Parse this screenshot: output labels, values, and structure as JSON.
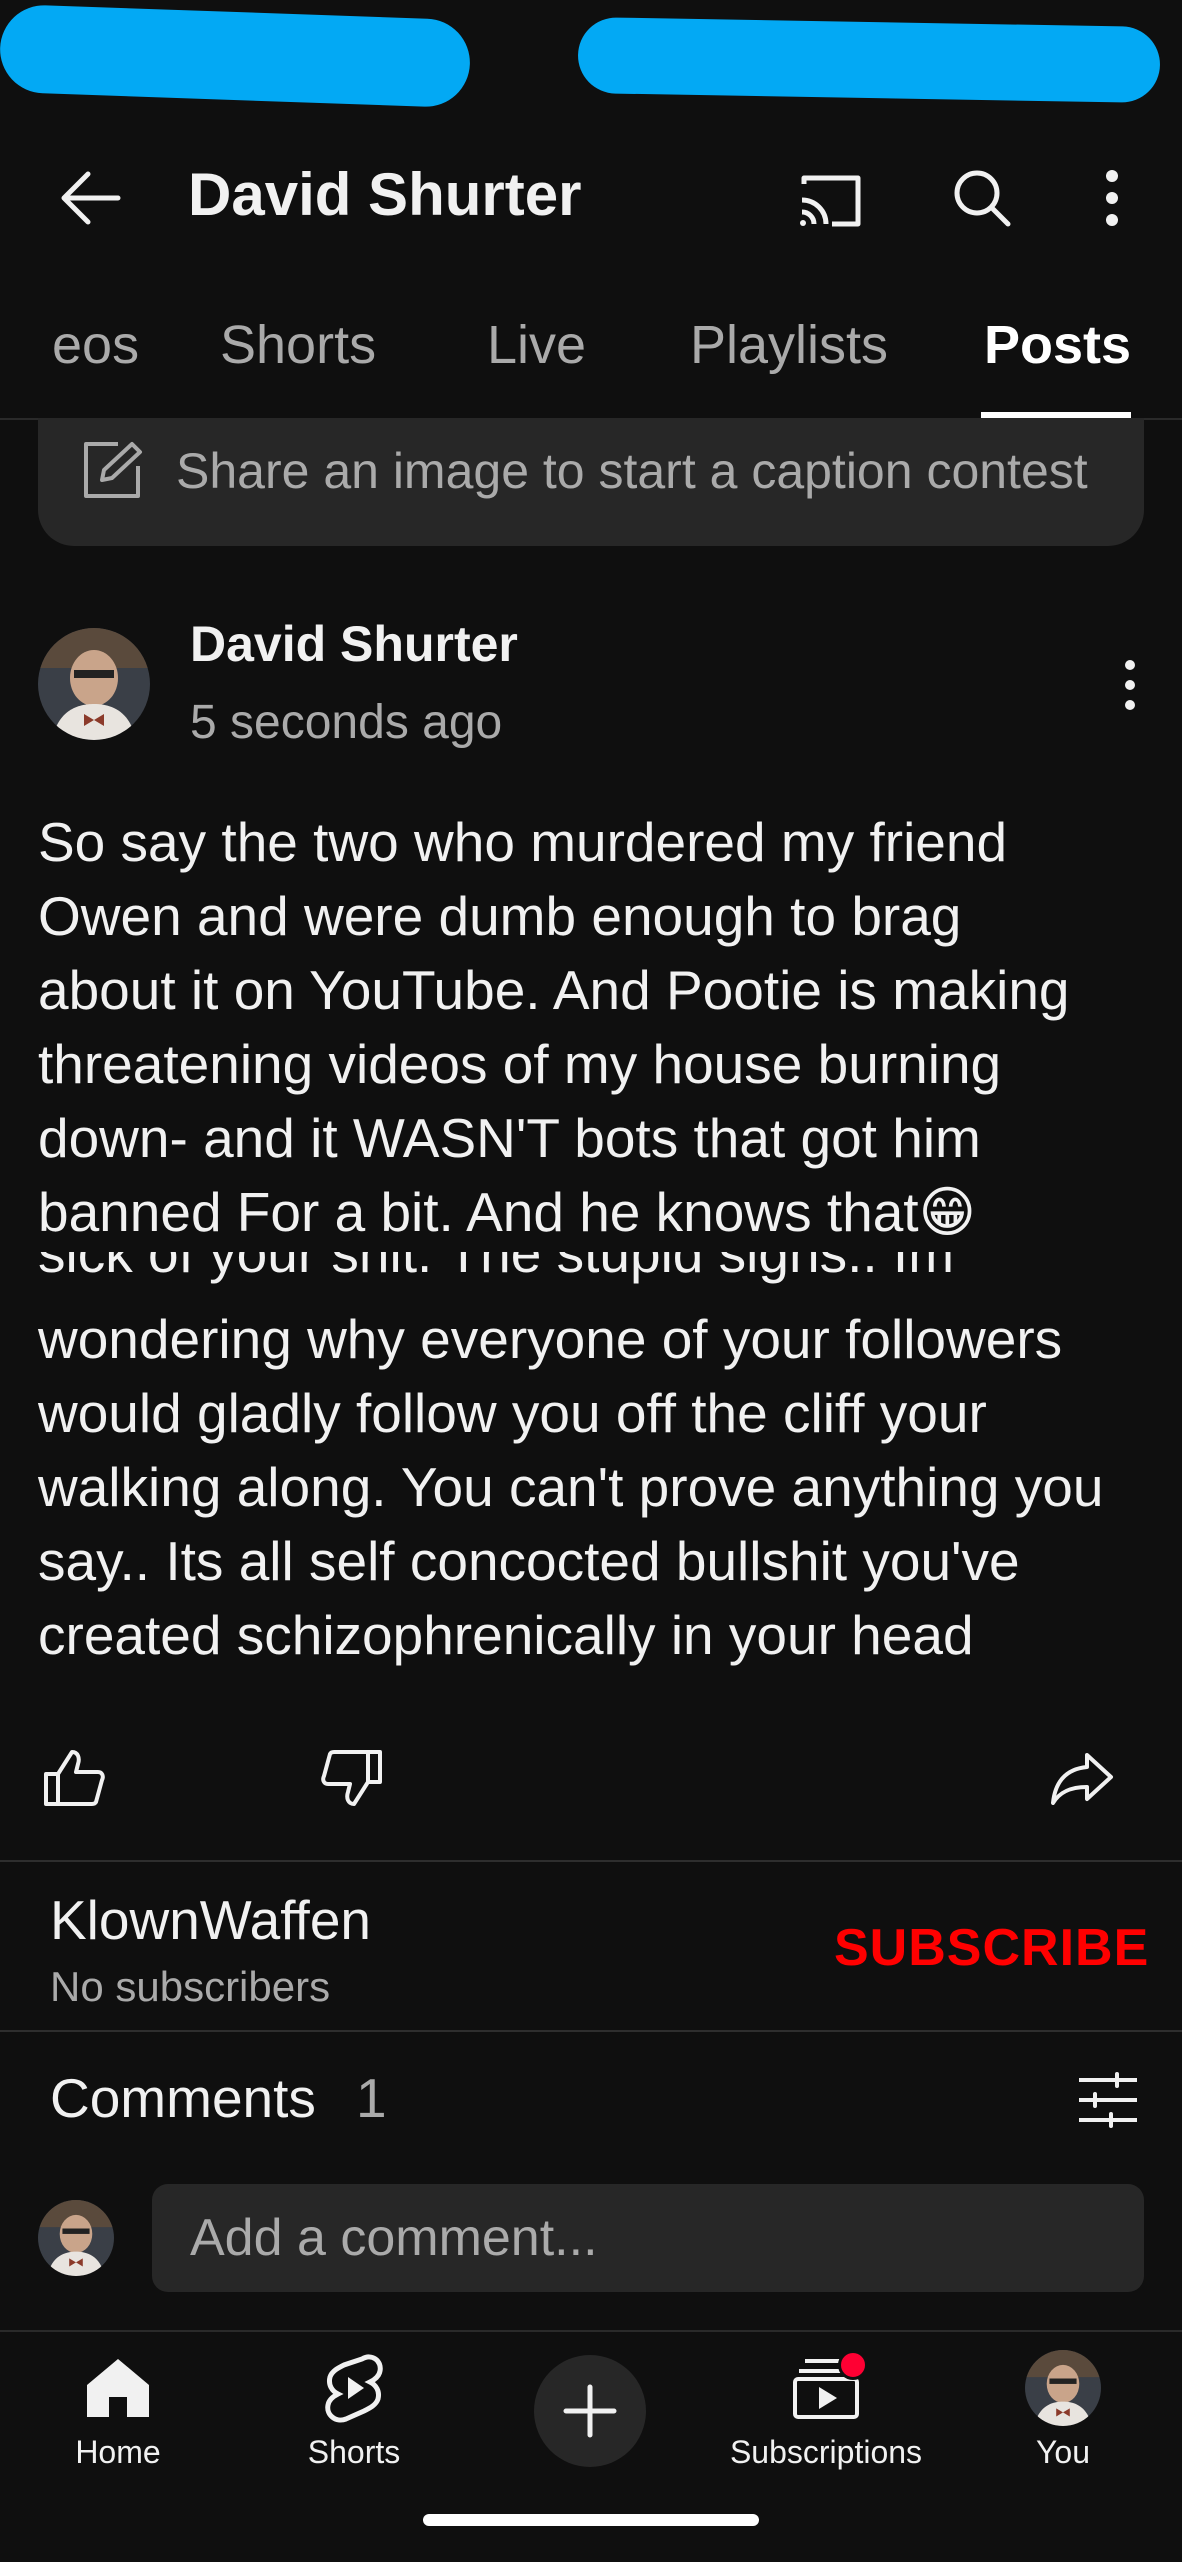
{
  "header": {
    "title": "David Shurter",
    "back_icon": "back-arrow-icon",
    "cast_icon": "cast-icon",
    "search_icon": "search-icon",
    "more_icon": "more-vert-icon"
  },
  "tabs": [
    {
      "label": "eos"
    },
    {
      "label": "Shorts"
    },
    {
      "label": "Live"
    },
    {
      "label": "Playlists"
    },
    {
      "label": "Posts",
      "active": true
    }
  ],
  "share_prompt": "Share an image to start a caption contest",
  "post": {
    "author": "David Shurter",
    "time": "5 seconds ago",
    "lines": [
      "So say the two who murdered my friend",
      "Owen and were dumb enough to brag",
      "about it on YouTube. And Pootie is making",
      "threatening videos of my house burning",
      "down- and it WASN'T bots that got him",
      "banned For a bit. And he knows that😁"
    ],
    "image_text": {
      "cut_line": "sick of your shit. The stupid signs.. Im",
      "lines": [
        "wondering why everyone of your followers",
        "would gladly follow you off the cliff your",
        "walking along. You can't prove anything you",
        "say.. Its all self concocted bullshit you've",
        "created schizophrenically in your head"
      ]
    }
  },
  "subscriber": {
    "name": "KlownWaffen",
    "count": "No subscribers",
    "button": "SUBSCRIBE"
  },
  "comments": {
    "label": "Comments",
    "count": "1",
    "placeholder": "Add a comment..."
  },
  "nav": {
    "items": [
      {
        "label": "Home",
        "icon": "home-icon"
      },
      {
        "label": "Shorts",
        "icon": "shorts-icon"
      },
      {
        "label": "",
        "icon": "create-plus-icon"
      },
      {
        "label": "Subscriptions",
        "icon": "subscriptions-icon"
      },
      {
        "label": "You",
        "icon": "avatar"
      }
    ]
  },
  "colors": {
    "background": "#0f0f0f",
    "accent_subscribe": "#ff0000",
    "notification_dot": "#ff0033",
    "scribble": "#03a9f4"
  }
}
